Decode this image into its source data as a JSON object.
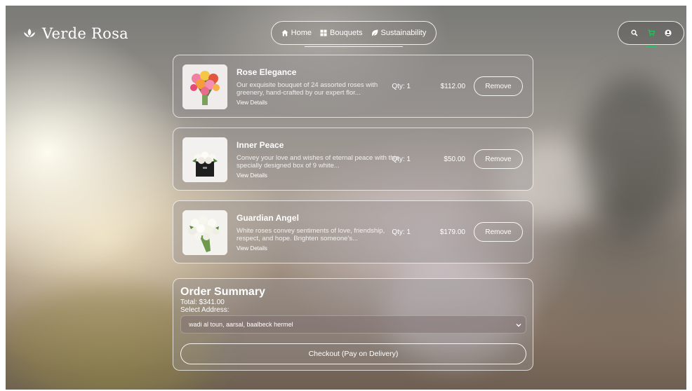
{
  "brand": {
    "name": "Verde Rosa",
    "icon": "lotus-icon"
  },
  "nav": {
    "items": [
      {
        "label": "Home",
        "icon": "home-icon"
      },
      {
        "label": "Bouquets",
        "icon": "bouquet-icon"
      },
      {
        "label": "Sustainability",
        "icon": "leaf-icon"
      }
    ]
  },
  "header_actions": {
    "search_icon": "search-icon",
    "cart_icon": "cart-icon",
    "user_icon": "user-icon",
    "cart_accent": "#22c55e"
  },
  "cart": {
    "items": [
      {
        "name": "Rose Elegance",
        "description": "Our exquisite bouquet of 24 assorted roses with greenery, hand-crafted by our expert flor...",
        "link": "View Details",
        "qty": "Qty: 1",
        "price": "$112.00",
        "remove": "Remove"
      },
      {
        "name": "Inner Peace",
        "description": "Convey your love and wishes of eternal peace with this specially designed box of 9 white...",
        "link": "View Details",
        "qty": "Qty: 1",
        "price": "$50.00",
        "remove": "Remove"
      },
      {
        "name": "Guardian Angel",
        "description": "White roses convey sentiments of love, friendship, respect, and hope. Brighten someone's...",
        "link": "View Details",
        "qty": "Qty: 1",
        "price": "$179.00",
        "remove": "Remove"
      }
    ]
  },
  "summary": {
    "title": "Order Summary",
    "total": "Total: $341.00",
    "address_label": "Select Address:",
    "address_selected": "wadi al toun, aarsal, baalbeck hermel",
    "checkout": "Checkout (Pay on Delivery)"
  }
}
